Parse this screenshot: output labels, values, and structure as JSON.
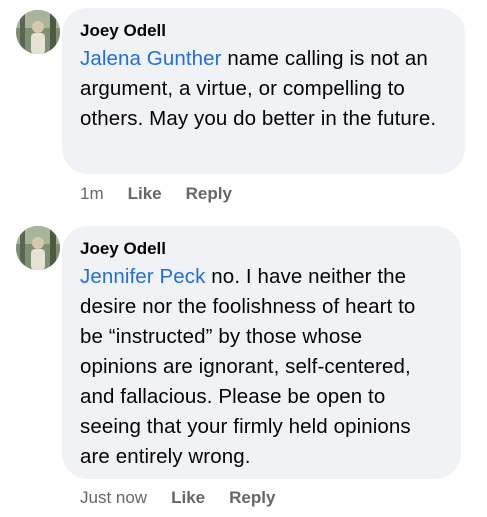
{
  "comments": [
    {
      "author": "Joey Odell",
      "mention": "Jalena Gunther",
      "text": " name calling is not an argument, a virtue, or compelling to others. May you do better in the future.",
      "time": "1m",
      "like_label": "Like",
      "reply_label": "Reply"
    },
    {
      "author": "Joey Odell",
      "mention": "Jennifer Peck",
      "text": " no.  I have neither the desire nor the foolishness of heart to be “instructed” by those whose opinions are ignorant, self-centered, and fallacious.  Please be open to seeing that your firmly held opinions are entirely wrong.",
      "time": "Just now",
      "like_label": "Like",
      "reply_label": "Reply"
    }
  ],
  "colors": {
    "bubble": "#f0f2f5",
    "mention": "#216fdb",
    "meta": "#65676b"
  }
}
